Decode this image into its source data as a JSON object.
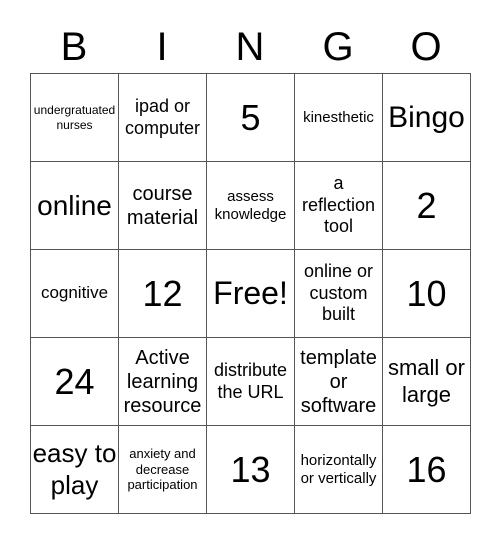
{
  "header": [
    "B",
    "I",
    "N",
    "G",
    "O"
  ],
  "cells": [
    [
      "undergratuated nurses",
      "ipad or computer",
      "5",
      "kinesthetic",
      "Bingo"
    ],
    [
      "online",
      "course material",
      "assess knowledge",
      "a reflection tool",
      "2"
    ],
    [
      "cognitive",
      "12",
      "Free!",
      "online or custom built",
      "10"
    ],
    [
      "24",
      "Active learning resource",
      "distribute the URL",
      "template or software",
      "small or large"
    ],
    [
      "easy to play",
      "anxiety and decrease participation",
      "13",
      "horizontally or vertically",
      "16"
    ]
  ]
}
